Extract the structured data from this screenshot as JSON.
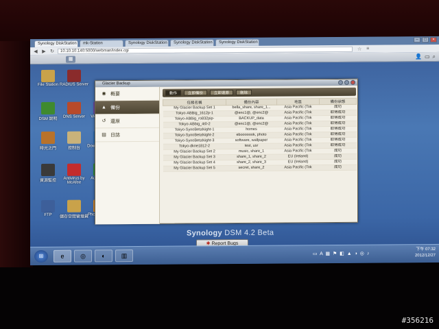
{
  "browser": {
    "tabs": [
      "Synology DiskStation",
      "mk-Station",
      "Synology DiskStation",
      "Synology DiskStation",
      "Synology DiskStation"
    ],
    "url": "10.10.10.140:5000/webman/index.cgi"
  },
  "desktop": {
    "icons": [
      {
        "label": "File Station",
        "icon": "folder-icon",
        "color": "#c9a24a"
      },
      {
        "label": "RADIUS Server",
        "icon": "radius-icon",
        "color": "#8a2b2b"
      },
      {
        "label": "DSM 說明",
        "icon": "help-icon",
        "color": "#3f8a2f"
      },
      {
        "label": "DNS Server",
        "icon": "dns-icon",
        "color": "#b84a2a"
      },
      {
        "label": "Video St...",
        "icon": "video-icon",
        "color": "#6a4aa0"
      },
      {
        "label": "時光之門",
        "icon": "timebackup-icon",
        "color": "#b8722a"
      },
      {
        "label": "控制台",
        "icon": "control-panel-icon",
        "color": "#c9b27a"
      },
      {
        "label": "Down... Stat...",
        "icon": "download-icon",
        "color": "#2e6db0"
      },
      {
        "label": "資源監控",
        "icon": "resource-monitor-icon",
        "color": "#3a3a3a"
      },
      {
        "label": "Antivirus by McAfee",
        "icon": "antivirus-icon",
        "color": "#c42c2c"
      },
      {
        "label": "Audio St...",
        "icon": "audio-icon",
        "color": "#2f8a3a"
      },
      {
        "label": "FTP",
        "icon": "ftp-icon",
        "color": "#3d5f9a"
      },
      {
        "label": "儲存空間管理員",
        "icon": "storage-icon",
        "color": "#c9a24a"
      },
      {
        "label": "Photo Station",
        "icon": "photo-icon",
        "color": "#d98a2a"
      }
    ]
  },
  "glacier": {
    "title": "Glacier Backup",
    "nav": [
      {
        "label": "概要",
        "icon": "overview-icon"
      },
      {
        "label": "備份",
        "icon": "backup-icon"
      },
      {
        "label": "還原",
        "icon": "restore-icon"
      },
      {
        "label": "日誌",
        "icon": "log-icon"
      }
    ],
    "toolbar": [
      "動作",
      "立即備份",
      "立即還原",
      "刪除"
    ],
    "table": {
      "headers": [
        "任務名稱",
        "備份內容",
        "地區",
        "備份狀態"
      ],
      "rows": [
        [
          "My Glacier Backup Set 1",
          "bella_share, share_1...",
          "Asia Pacific (Tok",
          "成功"
        ],
        [
          "Tokyo-ABBig_1612p-1",
          "@enc1@, @enc2@",
          "Asia Pacific (Tok",
          "取得成功"
        ],
        [
          "Tokyo-ABBig_ro832pip-",
          "BACKUP_data",
          "Asia Pacific (Tok",
          "取得成功"
        ],
        [
          "Tokyo-ABbig_4t0-2",
          "@enc1@, @enc2@",
          "Asia Pacific (Tok",
          "取得成功"
        ],
        [
          "Tokyo-SynoBetaNight-1",
          "homes",
          "Asia Pacific (Tok",
          "取得成功"
        ],
        [
          "Tokyo-SynoBetaNight-2",
          "ebooooook, photo",
          "Asia Pacific (Tok",
          "取得成功"
        ],
        [
          "Tokyo-SynoBetaNight-3",
          "software, wallpaper",
          "Asia Pacific (Tok",
          "取得成功"
        ],
        [
          "Tokyo-dkne1812-2",
          "test, usr",
          "Asia Pacific (Tok",
          "取得成功"
        ],
        [
          "My Glacier Backup Set 2",
          "music, share_1",
          "Asia Pacific (Tok",
          "成功"
        ],
        [
          "My Glacier Backup Set 3",
          "share_1, share_2",
          "EU (Ireland)",
          "成功"
        ],
        [
          "My Glacier Backup Set 4",
          "share_2, share_3",
          "EU (Ireland)",
          "成功"
        ],
        [
          "My Glacier Backup Set 5",
          "secret, share_2",
          "Asia Pacific (Tok",
          "成功"
        ]
      ]
    }
  },
  "brand": {
    "name": "Synology",
    "product": "DSM 4.2 Beta"
  },
  "report_bugs": "Report Bugs",
  "taskbar": {
    "apps": [
      "ie-icon",
      "chrome-icon",
      "firefox-icon",
      "explorer-icon"
    ],
    "time": "下午 07:32",
    "date": "2012/12/27"
  },
  "watermark": "#356216",
  "colors": {
    "selected_nav": "#5d5441",
    "desktop": "#3f6aa8",
    "close": "#c2524a"
  }
}
